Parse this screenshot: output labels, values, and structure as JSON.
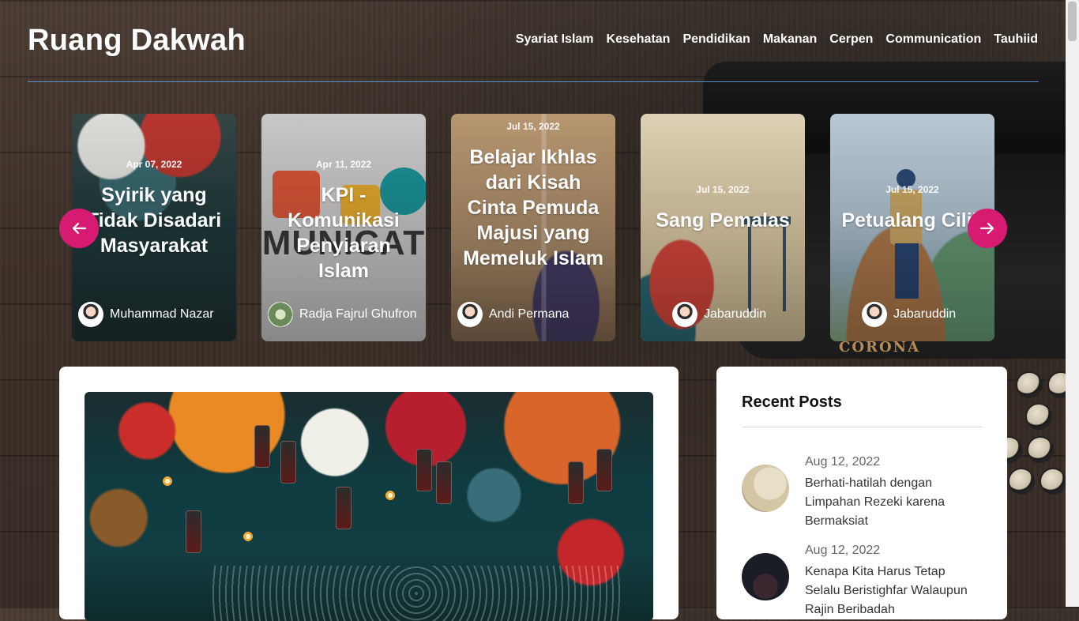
{
  "site": {
    "title": "Ruang Dakwah"
  },
  "nav": [
    "Syariat Islam",
    "Kesehatan",
    "Pendidikan",
    "Makanan",
    "Cerpen",
    "Communication",
    "Tauhiid"
  ],
  "carousel": {
    "prev_icon": "arrow-left-icon",
    "next_icon": "arrow-right-icon",
    "accent": "#d81b72",
    "cards": [
      {
        "date": "Apr 07, 2022",
        "title": "Syirik yang Tidak Disadari Masyarakat",
        "author": "Muhammad Nazar"
      },
      {
        "date": "Apr 11, 2022",
        "title": "KPI - Komunikasi Penyiaran Islam",
        "author": "Radja Fajrul Ghufron"
      },
      {
        "date": "Jul 15, 2022",
        "title": "Belajar Ikhlas dari Kisah Cinta Pemuda Majusi yang Memeluk Islam",
        "author": "Andi Permana"
      },
      {
        "date": "Jul 15, 2022",
        "title": "Sang Pemalas",
        "author": "Jabaruddin"
      },
      {
        "date": "Jul 15, 2022",
        "title": "Petualang Cilik",
        "author": "Jabaruddin"
      }
    ]
  },
  "sidebar": {
    "heading": "Recent Posts",
    "posts": [
      {
        "date": "Aug 12, 2022",
        "title": "Berhati-hatilah dengan Limpahan Rezeki karena Bermaksiat"
      },
      {
        "date": "Aug 12, 2022",
        "title": "Kenapa Kita Harus Tetap Selalu Beristighfar Walaupun Rajin Beribadah"
      }
    ]
  }
}
